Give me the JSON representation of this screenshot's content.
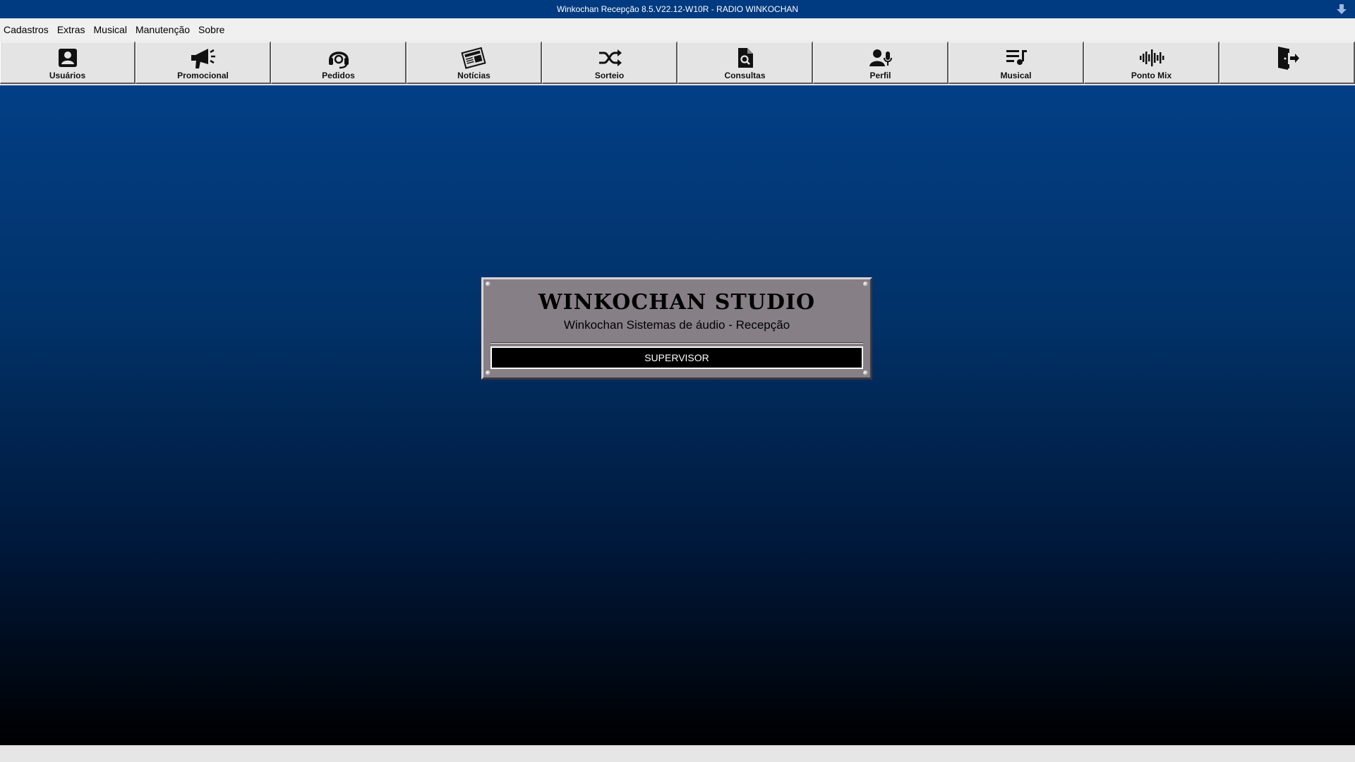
{
  "window": {
    "title": "Winkochan Recepção 8.5.V22.12-W10R - RADIO WINKOCHAN"
  },
  "menu": {
    "items": [
      {
        "label": "Cadastros"
      },
      {
        "label": "Extras"
      },
      {
        "label": "Musical"
      },
      {
        "label": "Manutenção"
      },
      {
        "label": "Sobre"
      }
    ]
  },
  "toolbar": {
    "buttons": [
      {
        "label": "Usuários",
        "icon": "user-card-icon"
      },
      {
        "label": "Promocional",
        "icon": "megaphone-icon"
      },
      {
        "label": "Pedidos",
        "icon": "headset-icon"
      },
      {
        "label": "Notícias",
        "icon": "newspaper-icon"
      },
      {
        "label": "Sorteio",
        "icon": "shuffle-icon"
      },
      {
        "label": "Consultas",
        "icon": "file-search-icon"
      },
      {
        "label": "Perfil",
        "icon": "user-mic-icon"
      },
      {
        "label": "Musical",
        "icon": "playlist-music-icon"
      },
      {
        "label": "Ponto Mix",
        "icon": "waveform-icon"
      },
      {
        "label": "",
        "icon": "exit-door-icon"
      }
    ]
  },
  "plaque": {
    "title": "WINKOCHAN STUDIO",
    "subtitle": "Winkochan Sistemas de áudio - Recepção",
    "user_role": "SUPERVISOR"
  },
  "colors": {
    "titlebar": "#003a80",
    "desktop_top": "#023f86",
    "desktop_bottom": "#000000",
    "plaque": "#868086",
    "toolbar": "#e4e4e4"
  }
}
